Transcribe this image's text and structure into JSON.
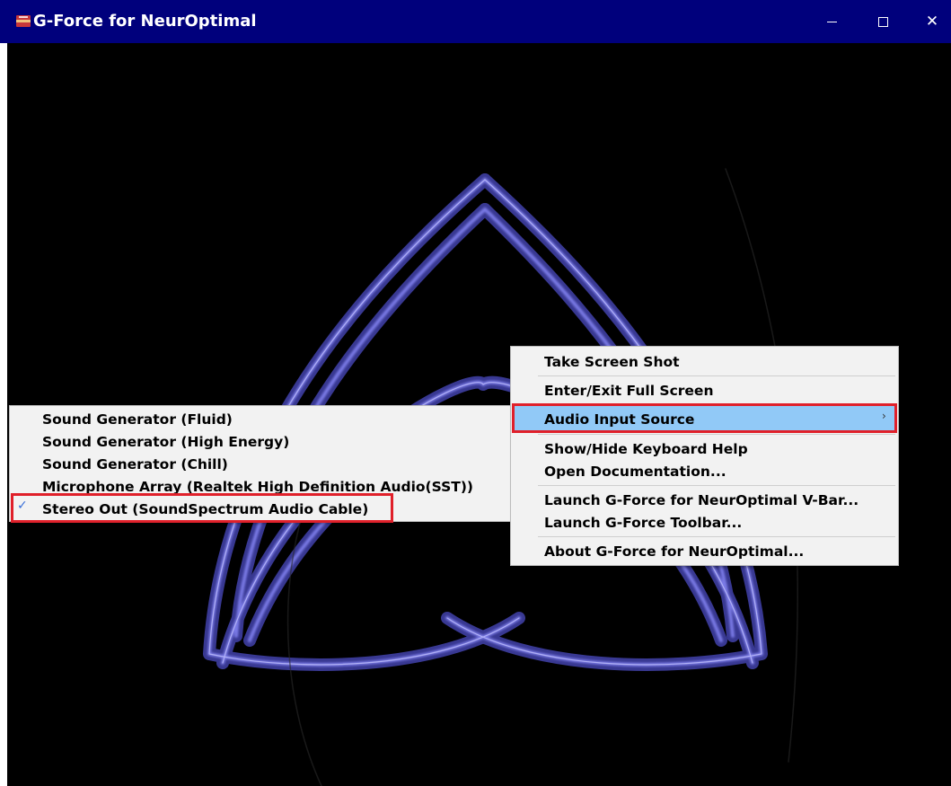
{
  "window": {
    "title": "G-Force for NeurOptimal",
    "minimize_glyph": "",
    "maximize_glyph": "",
    "close_glyph": "✕"
  },
  "colors": {
    "titlebar": "#00007c",
    "canvas": "#000000",
    "menu_bg": "#f2f2f2",
    "highlight": "#91c9f7",
    "annotation": "#e0202a",
    "visual_stroke": "#5b5bc8"
  },
  "context_menu": {
    "items": [
      {
        "label": "Take Screen Shot"
      },
      {
        "label": "Enter/Exit Full Screen"
      },
      {
        "label": "Audio Input Source",
        "has_submenu": true,
        "highlighted": true
      },
      {
        "label": "Show/Hide Keyboard Help"
      },
      {
        "label": "Open Documentation..."
      },
      {
        "label": "Launch G-Force for NeurOptimal V-Bar..."
      },
      {
        "label": "Launch G-Force Toolbar..."
      },
      {
        "label": "About G-Force for NeurOptimal..."
      }
    ],
    "submenu_arrow_glyph": "›"
  },
  "audio_submenu": {
    "items": [
      {
        "label": "Sound Generator (Fluid)"
      },
      {
        "label": "Sound Generator (High Energy)"
      },
      {
        "label": "Sound Generator (Chill)"
      },
      {
        "label": "Microphone Array (Realtek High Definition Audio(SST))"
      },
      {
        "label": "Stereo Out (SoundSpectrum Audio Cable)",
        "checked": true
      }
    ],
    "check_glyph": "✓"
  },
  "icons": {
    "app": "app-icon",
    "minimize": "minimize-icon",
    "maximize": "maximize-icon",
    "close": "close-icon",
    "submenu": "chevron-right-icon",
    "check": "checkmark-icon"
  }
}
